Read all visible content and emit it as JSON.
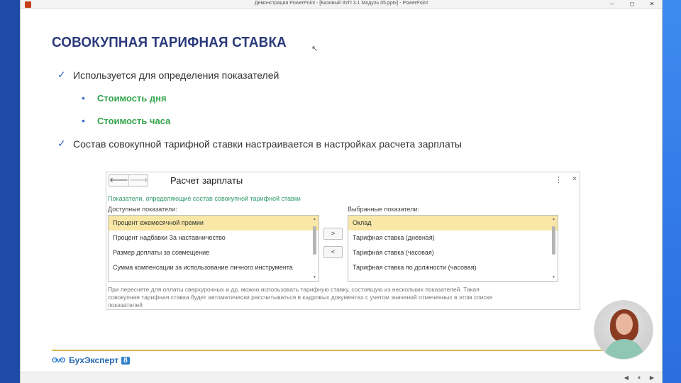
{
  "window": {
    "title": "Демонстрация PowerPoint - [Базовый ЗУП 3.1 Модуль 05.pptx] - PowerPoint",
    "minimize": "–",
    "maximize": "◻",
    "close": "✕"
  },
  "slide": {
    "title": "СОВОКУПНАЯ ТАРИФНАЯ СТАВКА",
    "bullet1": "Используется для определения показателей",
    "sub1": "Стоимость дня",
    "sub2": "Стоимость часа",
    "bullet2": "Состав совокупной тарифной ставки настраивается в настройках расчета зарплаты",
    "check_glyph": "✓",
    "dot_glyph": "•"
  },
  "dialog": {
    "back": "🡐",
    "forward": "🡒",
    "title": "Расчет зарплаты",
    "more": "⋮",
    "close": "×",
    "subtitle": "Показатели, определяющие состав совокупной тарифной ставки",
    "available_label": "Доступные показатели:",
    "selected_label": "Выбранные показатели:",
    "available": [
      "Процент ежемесячной премии",
      "Процент надбавки За наставничество",
      "Размер доплаты за совмещение",
      "Сумма компенсации за использование личного инструмента"
    ],
    "selected": [
      "Оклад",
      "Тарифная ставка (дневная)",
      "Тарифная ставка (часовая)",
      "Тарифная ставка по должности (часовая)"
    ],
    "move_right": ">",
    "move_left": "<",
    "note": "При пересчете для оплаты сверхурочных и др. можно использовать тарифную ставку, состоящую из нескольких показателей. Такая совокупная тарифная ставка будет автоматически рассчитываться в кадровых документах с учетом значений отмеченных в этом списке показателей"
  },
  "footer": {
    "owl": "ʘvʘ",
    "brand": "БухЭксперт",
    "badge": "8"
  },
  "statusbar": {
    "prev": "◀",
    "pause": "⏸",
    "next": "▶"
  }
}
